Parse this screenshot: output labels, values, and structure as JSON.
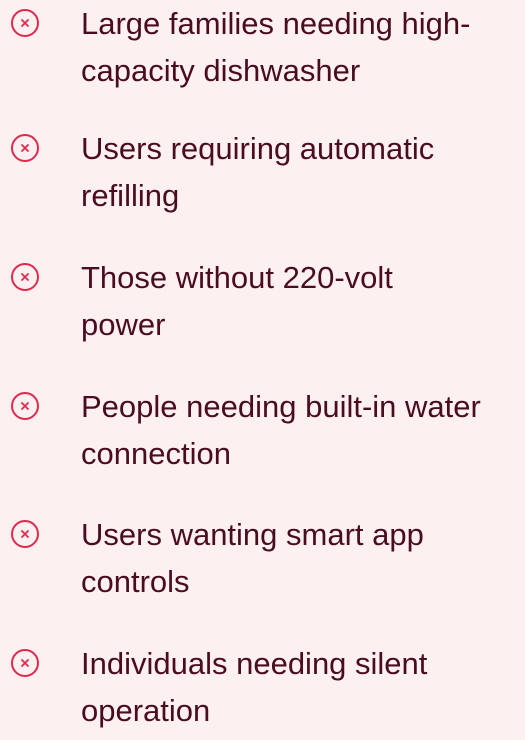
{
  "theme": {
    "background": "#fdf0f1",
    "text_color": "#4a0d1f",
    "icon_color": "#e0294e"
  },
  "items": [
    {
      "icon": "close-circle-icon",
      "line1": "Large families needing high-",
      "line2": "capacity dishwasher"
    },
    {
      "icon": "close-circle-icon",
      "line1": "Users requiring automatic",
      "line2": "refilling"
    },
    {
      "icon": "close-circle-icon",
      "line1": "Those without 220-volt",
      "line2": "power"
    },
    {
      "icon": "close-circle-icon",
      "line1": "People needing built-in water",
      "line2": "connection"
    },
    {
      "icon": "close-circle-icon",
      "line1": "Users wanting smart app",
      "line2": "controls"
    },
    {
      "icon": "close-circle-icon",
      "line1": "Individuals needing silent",
      "line2": "operation"
    }
  ]
}
